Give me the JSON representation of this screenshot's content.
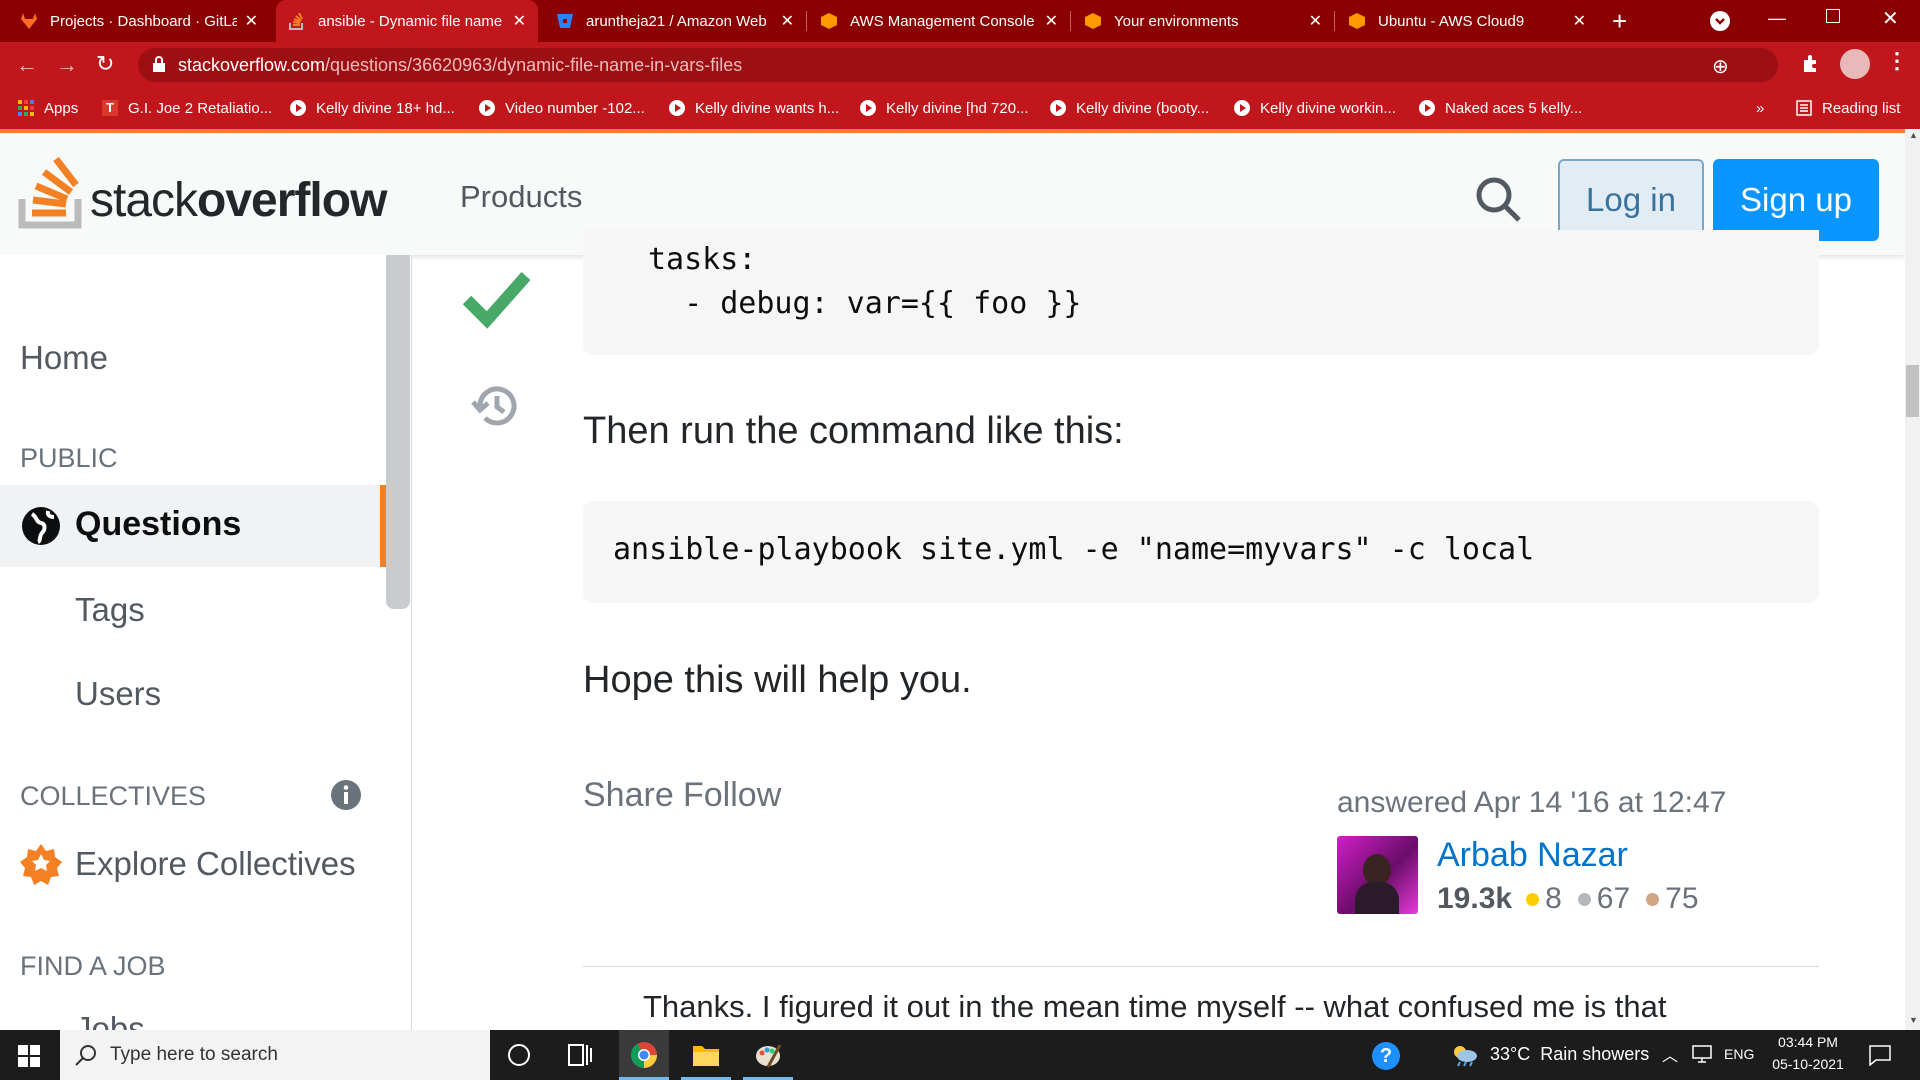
{
  "browser": {
    "tabs": [
      {
        "title": "Projects · Dashboard · GitLab",
        "icon": "gitlab-icon"
      },
      {
        "title": "ansible - Dynamic file name",
        "icon": "stackoverflow-icon",
        "active": true
      },
      {
        "title": "aruntheja21 / Amazon Web",
        "icon": "bitbucket-icon"
      },
      {
        "title": "AWS Management Console",
        "icon": "aws-icon"
      },
      {
        "title": "Your environments",
        "icon": "aws-icon"
      },
      {
        "title": "Ubuntu - AWS Cloud9",
        "icon": "aws-icon"
      }
    ],
    "url_host": "stackoverflow.com",
    "url_path": "/questions/36620963/dynamic-file-name-in-vars-files",
    "bookmarks": [
      "Apps",
      "G.I. Joe 2 Retaliatio...",
      "Kelly divine 18+ hd...",
      "Video number -102...",
      "Kelly divine wants h...",
      "Kelly divine [hd 720...",
      "Kelly divine (booty...",
      "Kelly divine workin...",
      "Naked aces 5 kelly..."
    ],
    "reading_list": "Reading list",
    "more_bookmarks": "»"
  },
  "so": {
    "logo_light": "stack",
    "logo_bold": "overflow",
    "products": "Products",
    "login": "Log in",
    "signup": "Sign up"
  },
  "sidebar": {
    "home": "Home",
    "public": "PUBLIC",
    "questions": "Questions",
    "tags": "Tags",
    "users": "Users",
    "collectives": "COLLECTIVES",
    "explore": "Explore Collectives",
    "find_job": "FIND A JOB",
    "jobs_partial": "Jobs"
  },
  "answer": {
    "code1_line1": "tasks:",
    "code1_line2": "  - debug: var={{ foo }}",
    "para1": "Then run the command like this:",
    "code2": "ansible-playbook site.yml -e \"name=myvars\" -c local",
    "para2": "Hope this will help you.",
    "share": "Share",
    "follow": "Follow",
    "answered": "answered Apr 14 '16 at 12:47",
    "user": "Arbab Nazar",
    "rep": "19.3k",
    "gold": "8",
    "silver": "67",
    "bronze": "75",
    "comment": "Thanks. I figured it out in the mean time myself -- what confused me is that"
  },
  "taskbar": {
    "search_placeholder": "Type here to search",
    "weather": "33°C  Rain showers",
    "lang": "ENG",
    "time": "03:44 PM",
    "date": "05-10-2021"
  },
  "colors": {
    "so_orange": "#f48024",
    "so_blue": "#0a95ff",
    "accept_green": "#48a868",
    "chrome_red": "#c0161c"
  }
}
